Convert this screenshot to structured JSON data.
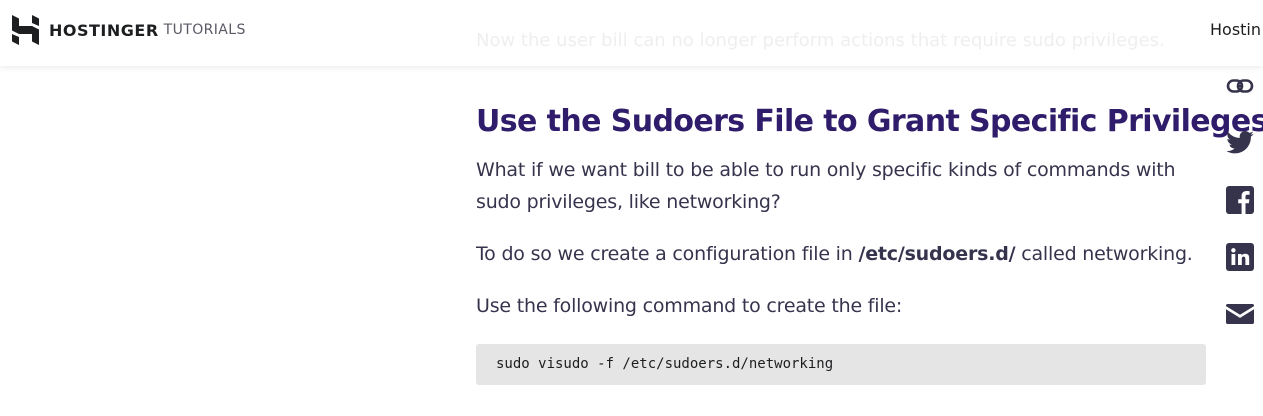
{
  "header": {
    "brand": "HOSTINGER",
    "brand_sub": "TUTORIALS",
    "nav_link": "Hostin"
  },
  "faded_text": "Now the user bill can no longer perform actions that require sudo privileges.",
  "article": {
    "heading": "Use the Sudoers File to Grant Specific Privileges",
    "paragraph1": "What if we want bill to be able to run only specific kinds of commands with sudo privileges, like networking?",
    "paragraph2_before": "To do so we create a configuration file in ",
    "paragraph2_bold": "/etc/sudoers.d/",
    "paragraph2_after": " called networking.",
    "paragraph3": "Use the following command to create the file:",
    "code": "sudo visudo -f /etc/sudoers.d/networking"
  },
  "share_icons": [
    "link-icon",
    "twitter-icon",
    "facebook-icon",
    "linkedin-icon",
    "email-icon"
  ],
  "colors": {
    "heading": "#2f1c6a",
    "body_text": "#36344d",
    "icon": "#36344d",
    "code_bg": "#e5e5e5"
  }
}
